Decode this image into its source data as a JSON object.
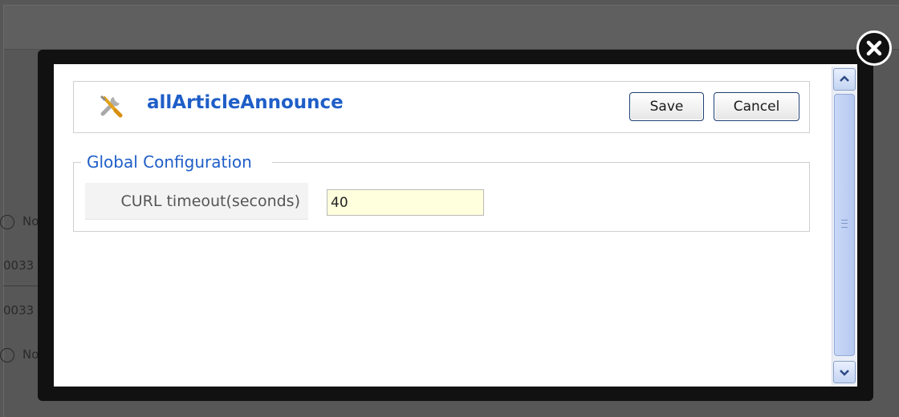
{
  "background": {
    "radio_label": "No",
    "cells": [
      "0033",
      "0033"
    ]
  },
  "modal": {
    "title": "allArticleAnnounce",
    "buttons": {
      "save_label": "Save",
      "cancel_label": "Cancel"
    },
    "fieldset": {
      "legend": "Global Configuration",
      "fields": [
        {
          "label": "CURL timeout(seconds)",
          "value": "40"
        }
      ]
    },
    "icons": {
      "close": "close-icon",
      "tool": "wrench-screwdriver-icon",
      "scroll_up": "chevron-up-icon",
      "scroll_down": "chevron-down-icon"
    }
  },
  "colors": {
    "title_blue": "#1f5ec8",
    "input_bg": "#ffffdd",
    "overlay": "#575757",
    "frame": "#111111"
  }
}
